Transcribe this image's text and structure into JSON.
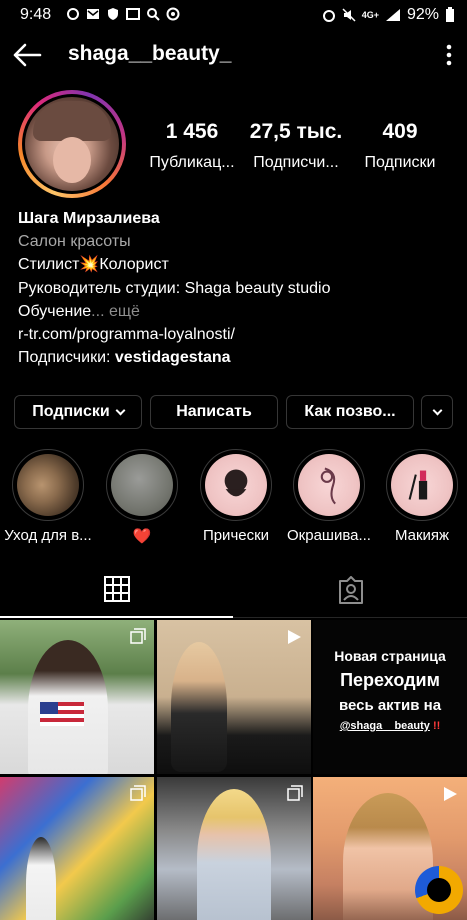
{
  "status_bar": {
    "time": "9:48",
    "network": "4G+",
    "battery": "92%"
  },
  "header": {
    "username": "shaga__beauty_"
  },
  "stats": [
    {
      "value": "1 456",
      "label": "Публикац..."
    },
    {
      "value": "27,5 тыс.",
      "label": "Подписчи..."
    },
    {
      "value": "409",
      "label": "Подписки"
    }
  ],
  "bio": {
    "name": "Шага Мирзалиева",
    "category": "Салон красоты",
    "line1": "Стилист💥Колорист",
    "line2": "Руководитель студии: Shaga beauty studio",
    "line3": "Обучение",
    "line3_more": "... ещё",
    "link": "r-tr.com/programma-loyalnosti/",
    "followed_prefix": "Подписчики: ",
    "followed_name": "vestidagestana"
  },
  "actions": {
    "subscribed": "Подписки",
    "message": "Написать",
    "contact": "Как позво..."
  },
  "highlights": [
    {
      "label": "Уход для в...",
      "icon": "hair-photo"
    },
    {
      "label": "❤️",
      "icon": "gray-photo"
    },
    {
      "label": "Прически",
      "icon": "hairstyle-icon"
    },
    {
      "label": "Окрашива...",
      "icon": "coloring-icon"
    },
    {
      "label": "Макияж",
      "icon": "makeup-icon"
    }
  ],
  "tabs": {
    "grid": "grid-icon",
    "tagged": "tagged-icon"
  },
  "posts": {
    "text_post": {
      "line1": "Новая страница",
      "line2": "Переходим",
      "line3": "весь актив на",
      "handle": "@shaga__beauty",
      "exclaim": " !!"
    }
  }
}
